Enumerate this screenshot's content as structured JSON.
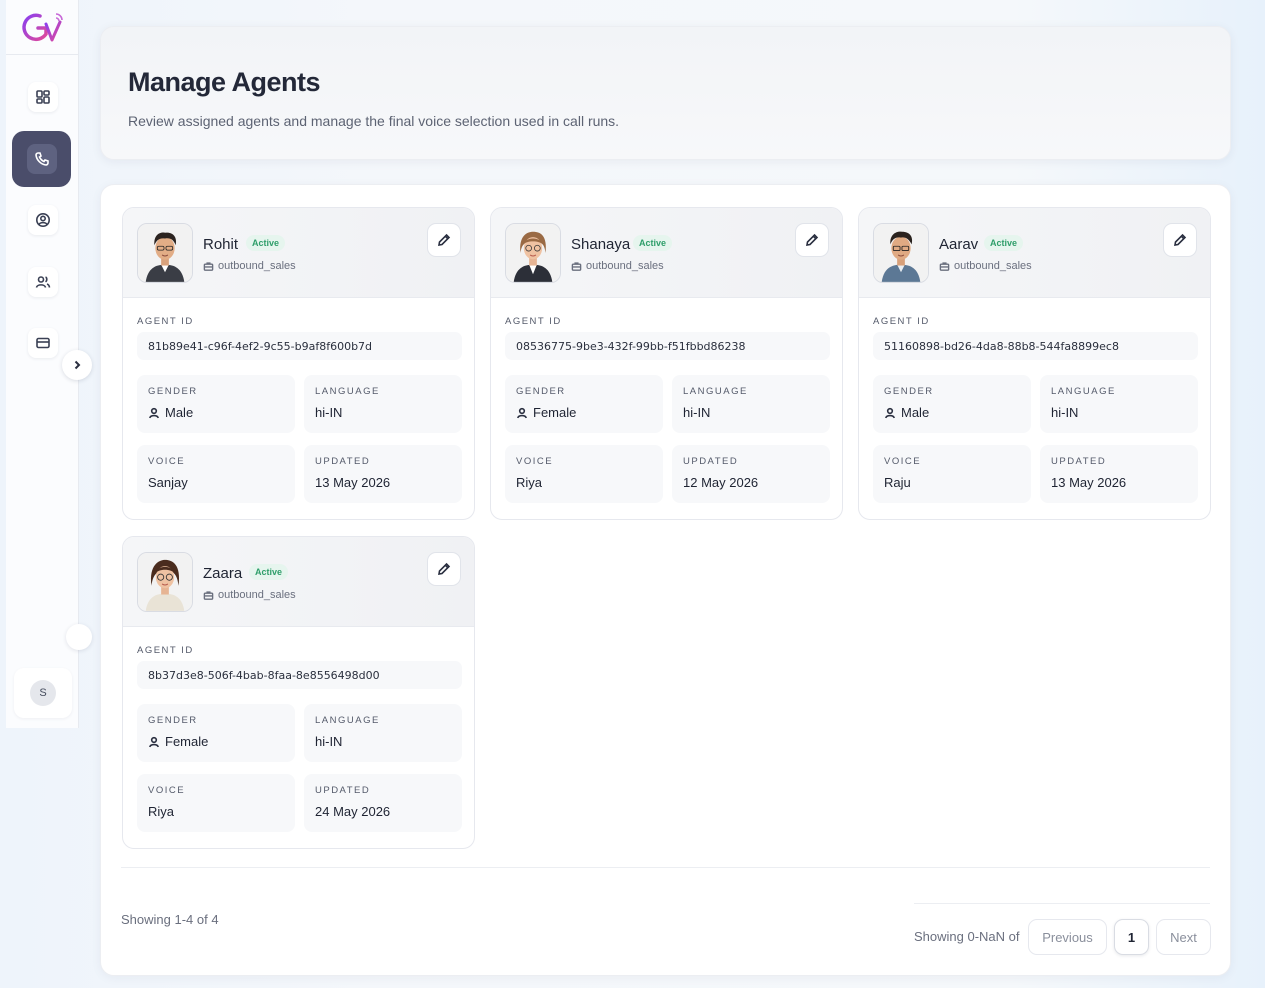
{
  "header": {
    "title": "Manage Agents",
    "subtitle": "Review assigned agents and manage the final voice selection used in call runs."
  },
  "sidebar": {
    "user_initial": "S"
  },
  "labels": {
    "agent_id": "AGENT ID",
    "gender": "GENDER",
    "language": "LANGUAGE",
    "voice": "VOICE",
    "updated": "UPDATED"
  },
  "agents": [
    {
      "name": "Rohit",
      "status": "Active",
      "team": "outbound_sales",
      "agent_id": "81b89e41-c96f-4ef2-9c55-b9af8f600b7d",
      "gender": "Male",
      "language": "hi-IN",
      "voice": "Sanjay",
      "updated": "13 May 2026"
    },
    {
      "name": "Shanaya",
      "status": "Active",
      "team": "outbound_sales",
      "agent_id": "08536775-9be3-432f-99bb-f51fbbd86238",
      "gender": "Female",
      "language": "hi-IN",
      "voice": "Riya",
      "updated": "12 May 2026"
    },
    {
      "name": "Aarav",
      "status": "Active",
      "team": "outbound_sales",
      "agent_id": "51160898-bd26-4da8-88b8-544fa8899ec8",
      "gender": "Male",
      "language": "hi-IN",
      "voice": "Raju",
      "updated": "13 May 2026"
    },
    {
      "name": "Zaara",
      "status": "Active",
      "team": "outbound_sales",
      "agent_id": "8b37d3e8-506f-4bab-8faa-8e8556498d00",
      "gender": "Female",
      "language": "hi-IN",
      "voice": "Riya",
      "updated": "24 May 2026"
    }
  ],
  "pagination": {
    "showing_left": "Showing 1-4 of 4",
    "showing_right": "Showing 0-NaN of",
    "previous": "Previous",
    "current": "1",
    "next": "Next"
  }
}
